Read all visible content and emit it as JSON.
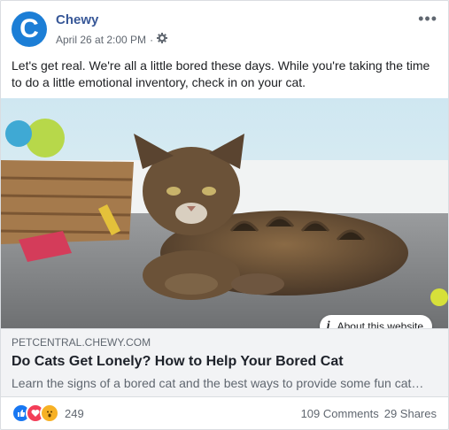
{
  "post": {
    "author": "Chewy",
    "avatar_letter": "C",
    "timestamp": "April 26 at 2:00 PM",
    "separator": "·",
    "more_icon": "•••",
    "text": "Let's get real. We're all a little bored these days. While you're taking the time to do a little emotional inventory, check in on your cat."
  },
  "link": {
    "about_label": "About this website",
    "domain": "PETCENTRAL.CHEWY.COM",
    "headline": "Do Cats Get Lonely? How to Help Your Bored Cat",
    "description": "Learn the signs of a bored cat and the best ways to provide some fun cat…"
  },
  "stats": {
    "reaction_count": "249",
    "comments": "109 Comments",
    "shares": "29 Shares"
  },
  "colors": {
    "accent": "#1c7ed6",
    "name": "#385898"
  }
}
